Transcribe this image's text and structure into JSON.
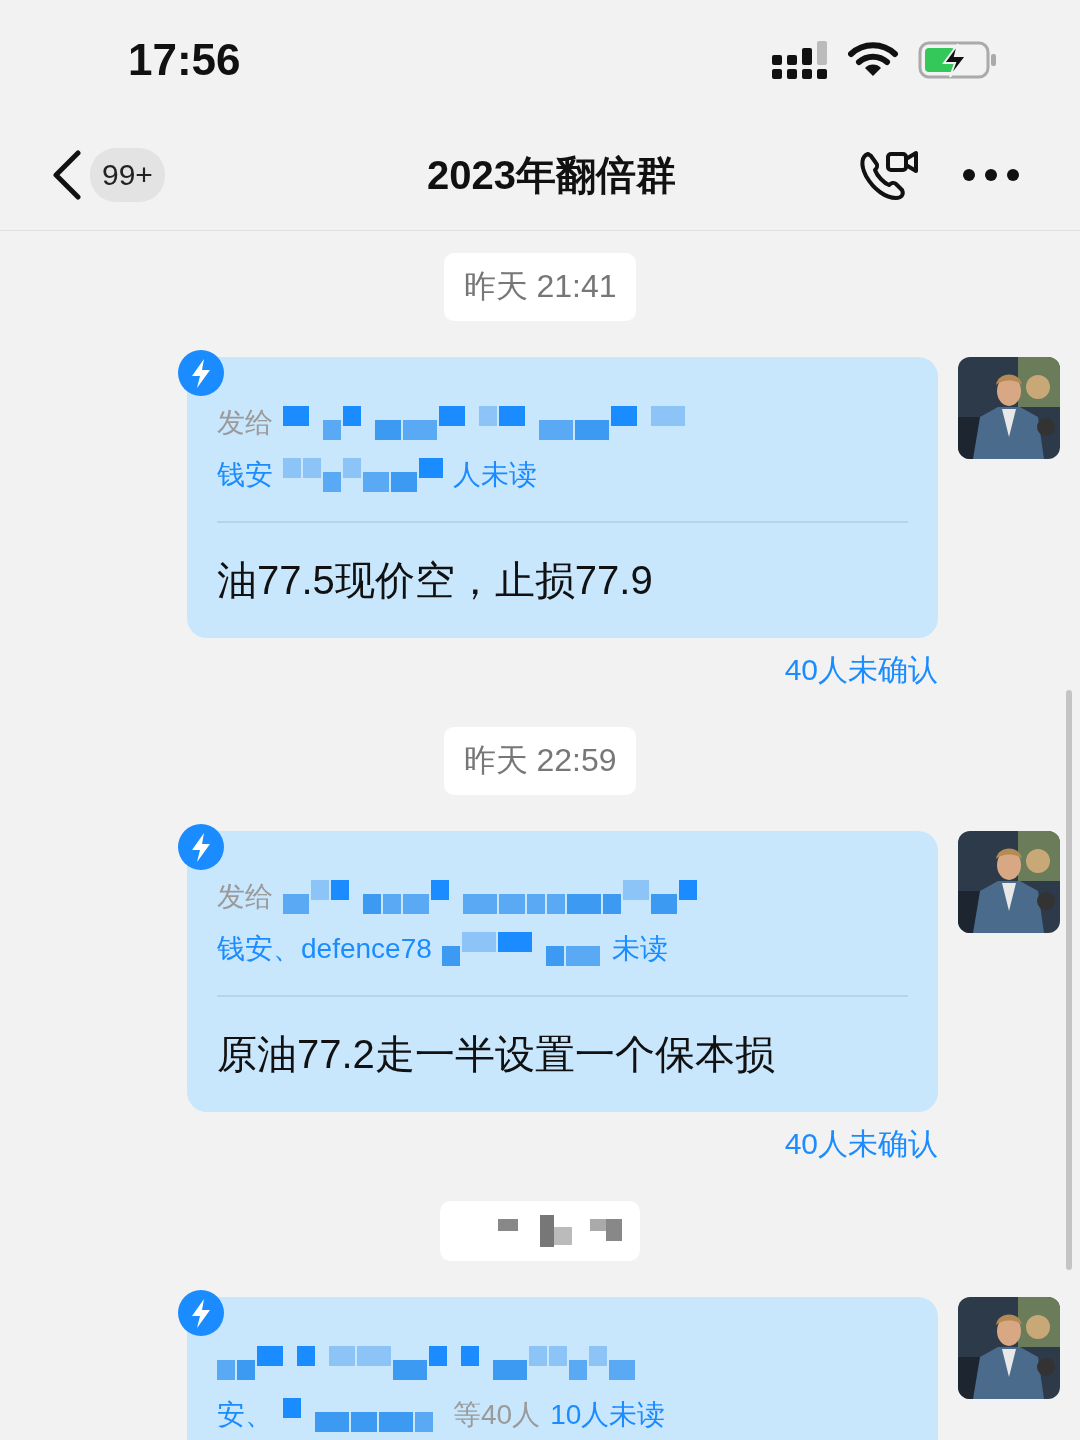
{
  "status_bar": {
    "time": "17:56"
  },
  "nav": {
    "badge": "99+",
    "title": "2023年翻倍群"
  },
  "feed": [
    {
      "kind": "time",
      "text": "昨天 21:41"
    },
    {
      "kind": "message",
      "lines": [
        [
          {
            "kind": "label",
            "text": "发给"
          },
          {
            "kind": "mosaic"
          }
        ],
        [
          {
            "kind": "name",
            "text": "钱安"
          },
          {
            "kind": "mosaic"
          },
          {
            "kind": "name",
            "text": "人未读"
          }
        ]
      ],
      "body": "油77.5现价空，止损77.9",
      "status": "40人未确认"
    },
    {
      "kind": "time",
      "text": "昨天 22:59"
    },
    {
      "kind": "message",
      "lines": [
        [
          {
            "kind": "label",
            "text": "发给"
          },
          {
            "kind": "mosaic"
          }
        ],
        [
          {
            "kind": "name",
            "text": "钱安、defence78"
          },
          {
            "kind": "mosaic"
          },
          {
            "kind": "name",
            "text": "未读"
          }
        ]
      ],
      "body": "原油77.2走一半设置一个保本损",
      "status": "40人未确认"
    },
    {
      "kind": "hidden_time"
    },
    {
      "kind": "message",
      "lines": [
        [
          {
            "kind": "mosaic"
          }
        ],
        [
          {
            "kind": "name",
            "text": "安、"
          },
          {
            "kind": "mosaic"
          },
          {
            "kind": "label",
            "text": "等40人"
          },
          {
            "kind": "name",
            "text": "10人未读"
          }
        ]
      ]
    }
  ]
}
